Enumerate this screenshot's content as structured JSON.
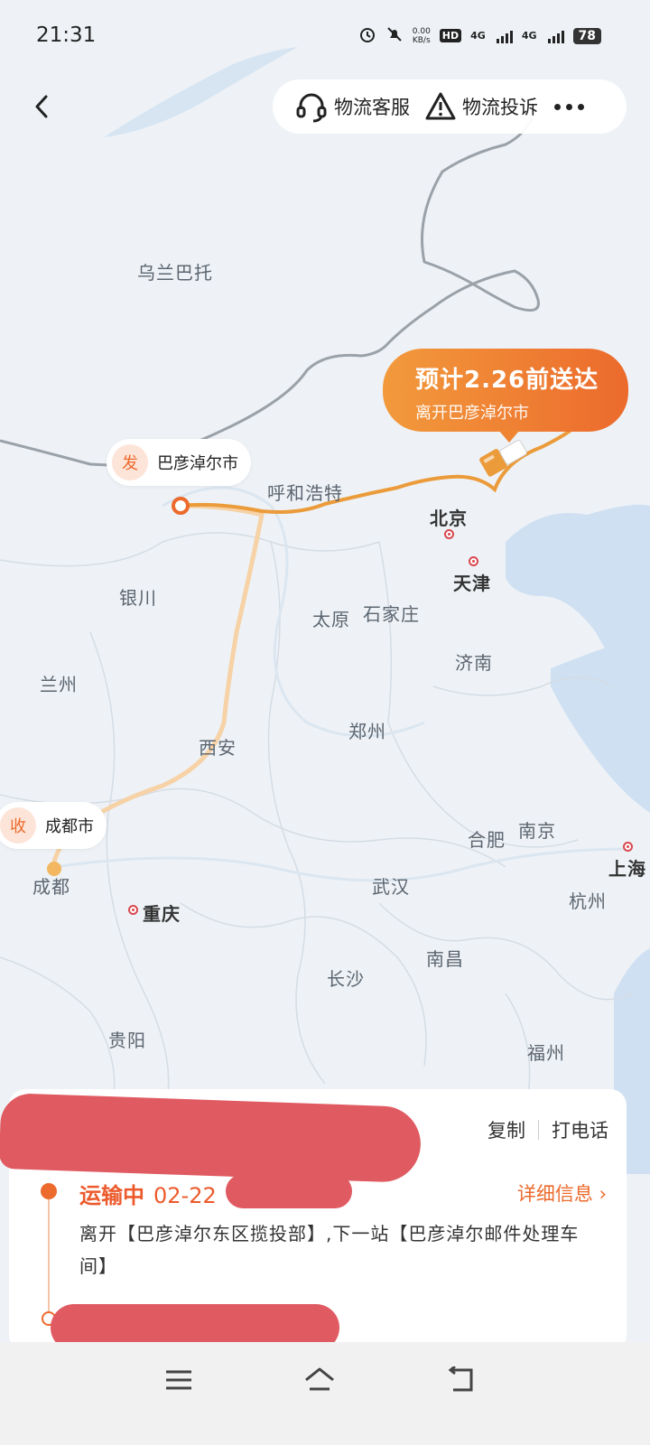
{
  "status_bar": {
    "time": "21:31",
    "net_speed": "0.00",
    "net_unit": "KB/s",
    "hd_label": "HD",
    "lte_1": "4G",
    "lte_2": "4G",
    "battery": "78"
  },
  "header": {
    "service_label": "物流客服",
    "complaint_label": "物流投诉"
  },
  "map": {
    "eta_title": "预计2.26前送达",
    "eta_sub": "离开巴彦淖尔市",
    "origin_badge": "发",
    "origin_city": "巴彦淖尔市",
    "dest_badge": "收",
    "dest_city": "成都市",
    "cities": {
      "wulanbatuo": "乌兰巴托",
      "huhehaote": "呼和浩特",
      "beijing": "北京",
      "tianjin": "天津",
      "yinchuan": "银川",
      "taiyuan": "太原",
      "shijiazhuang": "石家庄",
      "lanzhou": "兰州",
      "jinan": "济南",
      "xian": "西安",
      "zhengzhou": "郑州",
      "hefei": "合肥",
      "nanjing": "南京",
      "chengdu": "成都",
      "chongqing": "重庆",
      "wuhan": "武汉",
      "shanghai": "上海",
      "hangzhou": "杭州",
      "nanchang": "南昌",
      "changsha": "长沙",
      "guiyang": "贵阳",
      "fuzhou": "福州"
    }
  },
  "card": {
    "copy_label": "复制",
    "call_label": "打电话",
    "status": "运输中",
    "status_time": "02-22",
    "detail_label": "详细信息",
    "description": "离开【巴彦淖尔东区揽投部】,下一站【巴彦淖尔邮件处理车间】"
  }
}
